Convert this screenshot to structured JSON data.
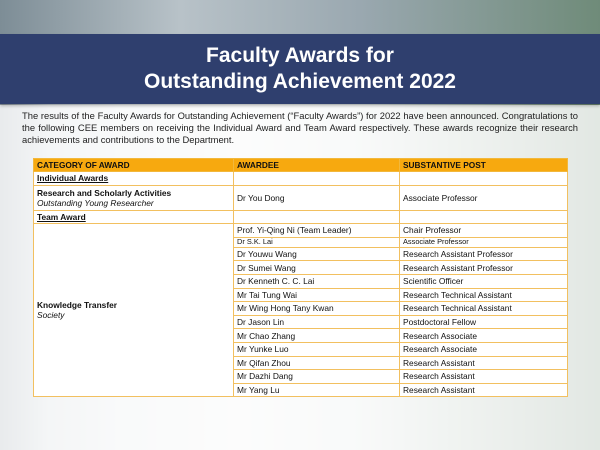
{
  "banner": {
    "title_line1": "Faculty Awards for",
    "title_line2": "Outstanding Achievement 2022"
  },
  "intro": "The results of the Faculty Awards for Outstanding Achievement (“Faculty Awards”) for 2022 have been announced. Congratulations to the following CEE members on receiving the Individual Award and Team Award respectively. These awards recognize their research achievements and contributions to the Department.",
  "table": {
    "headers": [
      "CATEGORY OF AWARD",
      "AWARDEE",
      "SUBSTANTIVE POST"
    ],
    "individual_section": "Individual Awards",
    "individual_row": {
      "category": "Research and Scholarly Activities",
      "subcategory": "Outstanding Young Researcher",
      "awardee": "Dr You Dong",
      "post": "Associate Professor"
    },
    "team_section": "Team Award",
    "team_category": "Knowledge Transfer",
    "team_subcategory": "Society",
    "team_rows": [
      {
        "awardee": "Prof. Yi-Qing Ni (Team Leader)",
        "post": "Chair Professor"
      },
      {
        "awardee": "Dr S.K. Lai",
        "post": "Associate Professor"
      },
      {
        "awardee": "Dr Youwu Wang",
        "post": "Research Assistant Professor"
      },
      {
        "awardee": "Dr Sumei Wang",
        "post": "Research Assistant Professor"
      },
      {
        "awardee": "Dr Kenneth C. C. Lai",
        "post": "Scientific Officer"
      },
      {
        "awardee": "Mr Tai Tung Wai",
        "post": "Research Technical Assistant"
      },
      {
        "awardee": "Mr Wing Hong Tany Kwan",
        "post": "Research Technical Assistant"
      },
      {
        "awardee": "Dr Jason Lin",
        "post": "Postdoctoral Fellow"
      },
      {
        "awardee": "Mr Chao Zhang",
        "post": "Research Associate"
      },
      {
        "awardee": "Mr Yunke Luo",
        "post": "Research Associate"
      },
      {
        "awardee": "Mr Qifan Zhou",
        "post": "Research Assistant"
      },
      {
        "awardee": "Mr Dazhi Dang",
        "post": "Research Assistant"
      },
      {
        "awardee": "Mr Yang Lu",
        "post": "Research Assistant"
      }
    ]
  }
}
